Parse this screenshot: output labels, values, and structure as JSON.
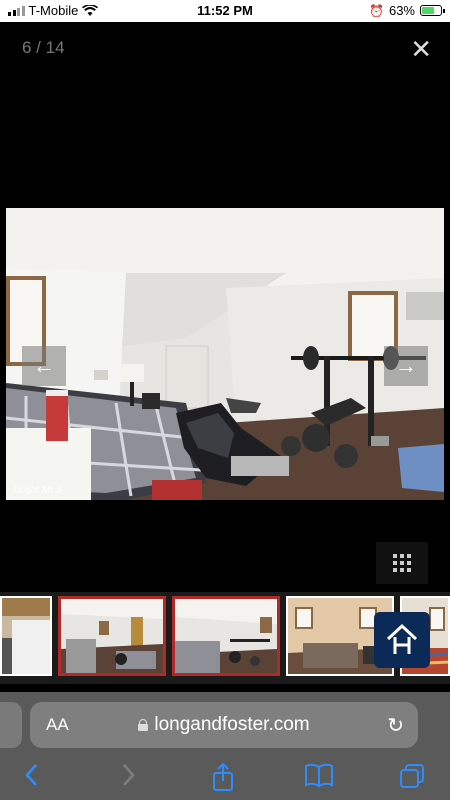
{
  "status_bar": {
    "carrier": "T-Mobile",
    "time": "11:52 PM",
    "battery": "63%"
  },
  "viewer": {
    "counter": "6 / 14",
    "close_label": "✕",
    "prev_label": "←",
    "next_label": "→",
    "watermark": "bright MLS"
  },
  "safari": {
    "aa_label": "AA",
    "url": "longandfoster.com",
    "reload_label": "↻"
  },
  "icons": {
    "back": "chevron-left-icon",
    "forward": "chevron-right-icon",
    "share": "share-icon",
    "bookmarks": "book-icon",
    "tabs": "tabs-icon"
  },
  "colors": {
    "active_thumb_border": "#b02a2a",
    "brand": "#0b2a57",
    "safari_accent": "#2f8cff"
  }
}
